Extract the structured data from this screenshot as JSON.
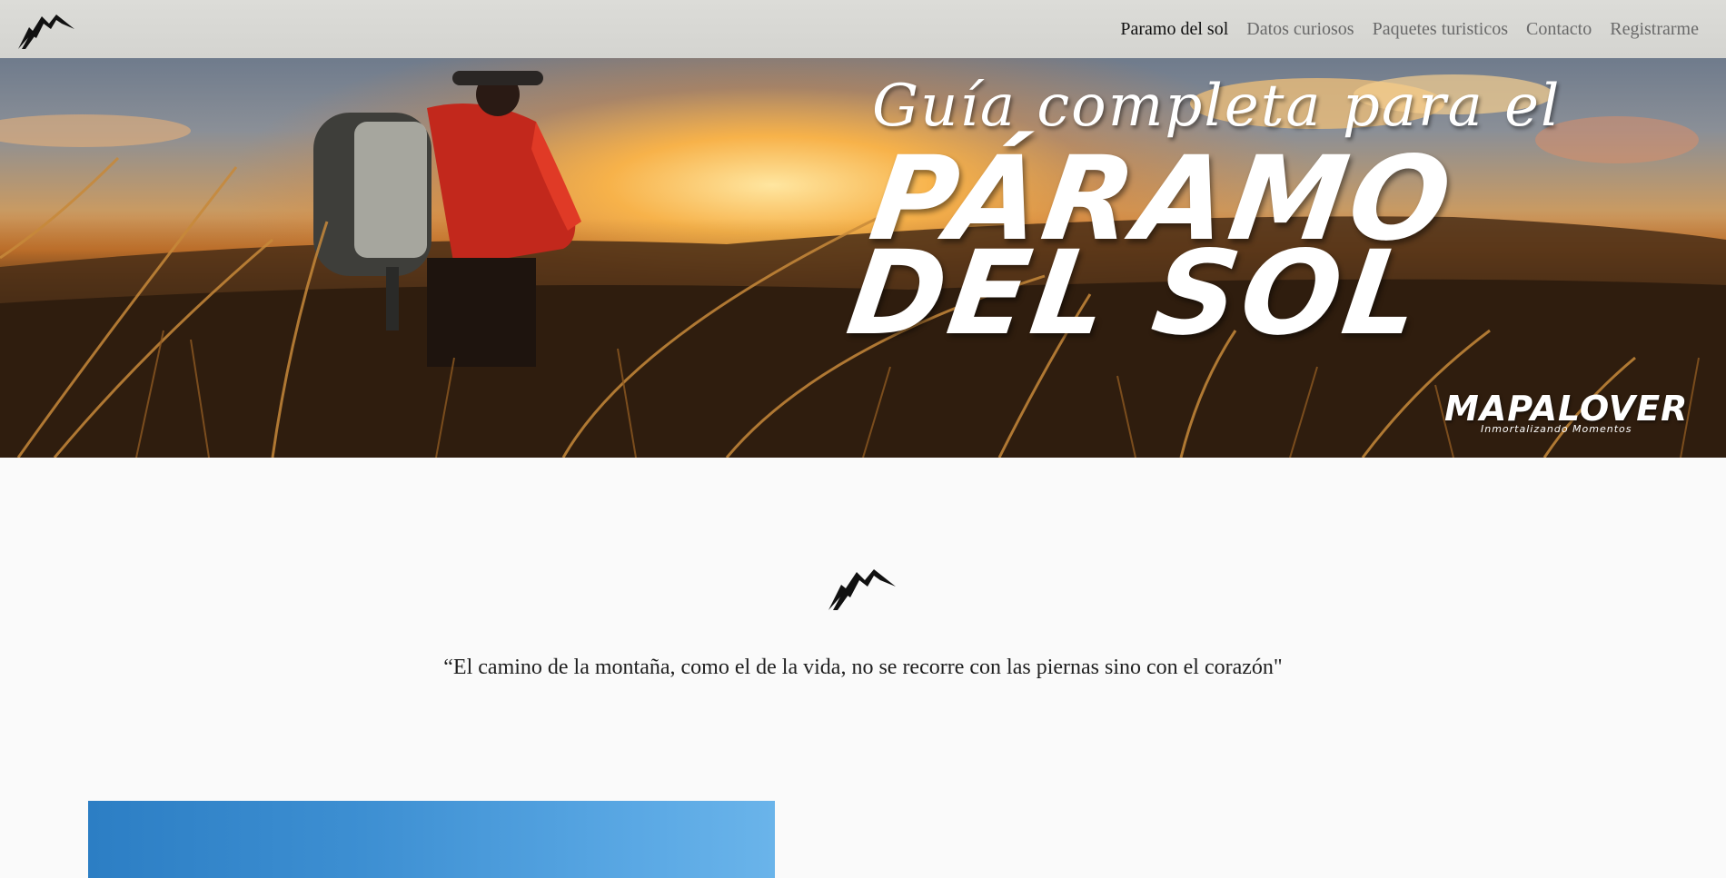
{
  "navbar": {
    "logo_icon": "mountain-icon",
    "links": [
      {
        "label": "Paramo del sol",
        "active": true
      },
      {
        "label": "Datos curiosos",
        "active": false
      },
      {
        "label": "Paquetes turisticos",
        "active": false
      },
      {
        "label": "Contacto",
        "active": false
      },
      {
        "label": "Registrarme",
        "active": false
      }
    ]
  },
  "hero": {
    "script_text": "Guía completa para el",
    "title_line1": "PÁRAMO",
    "title_line2": "DEL SOL",
    "brand_name": "MAPALOVER",
    "brand_tagline": "Inmortalizando Momentos"
  },
  "quote_section": {
    "logo_icon": "mountain-icon",
    "quote": "“El camino de la montaña, como el de la vida, no se recorre con las piernas sino con el corazón\""
  },
  "colors": {
    "nav_bg": "#d4d4d0",
    "nav_active": "#111111",
    "nav_inactive": "#6a6a6a",
    "page_bg": "#fafafa",
    "photo_sky": "#3d8fd2"
  }
}
